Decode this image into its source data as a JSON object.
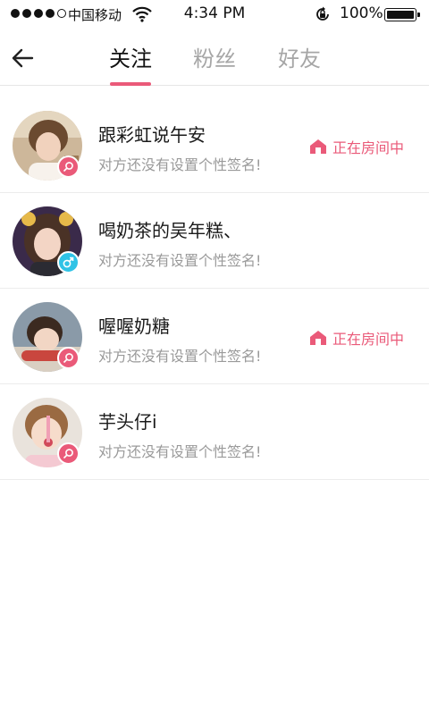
{
  "status_bar": {
    "carrier": "中国移动",
    "time": "4:34 PM",
    "battery": "100%",
    "signal_icon": "signal-dots-icon",
    "wifi_icon": "wifi-icon",
    "rotation_lock_icon": "rotation-lock-icon"
  },
  "header": {
    "back_icon": "arrow-left-icon",
    "tabs": [
      {
        "label": "关注",
        "active": true
      },
      {
        "label": "粉丝",
        "active": false
      },
      {
        "label": "好友",
        "active": false
      }
    ],
    "accent_color": "#ea5a79"
  },
  "users": [
    {
      "name": "跟彩虹说午安",
      "signature": "对方还没有设置个性签名!",
      "gender": "female",
      "status": "正在房间中"
    },
    {
      "name": "喝奶茶的吴年糕、",
      "signature": "对方还没有设置个性签名!",
      "gender": "male",
      "status": ""
    },
    {
      "name": "喔喔奶糖",
      "signature": "对方还没有设置个性签名!",
      "gender": "female",
      "status": "正在房间中"
    },
    {
      "name": "芋头仔i",
      "signature": "对方还没有设置个性签名!",
      "gender": "female",
      "status": ""
    }
  ],
  "colors": {
    "female_badge": "#ea5a79",
    "male_badge": "#2fc3e6",
    "status_text": "#ea5a79"
  }
}
